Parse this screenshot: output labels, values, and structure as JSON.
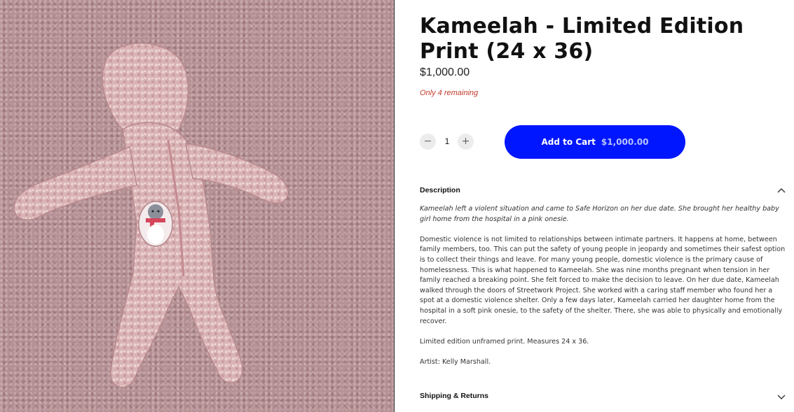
{
  "product": {
    "title": "Kameelah - Limited Edition Print (24 x 36)",
    "price": "$1,000.00",
    "stock_note": "Only 4 remaining",
    "image_subject": "pink fleece baby onesie with penguin patch on textured pink rug"
  },
  "quantity": {
    "minus_icon": "minus-icon",
    "value": "1",
    "plus_icon": "plus-icon"
  },
  "cart": {
    "label": "Add to Cart",
    "price": "$1,000.00",
    "color": "#0016ff"
  },
  "description": {
    "title": "Description",
    "state": "expanded",
    "intro": "Kameelah left a violent situation and came to Safe Horizon on her due date. She brought her healthy baby girl home from the hospital in a pink onesie.",
    "body": "Domestic violence is not limited to relationships between intimate partners. It happens at home, between family members, too. This can put the safety of young people in jeopardy and sometimes their safest option is to collect their things and leave. For many young people, domestic violence is the primary cause of homelessness. This is what happened to Kameelah. She was nine months pregnant when tension in her family reached a breaking point. She felt forced to make the decision to leave. On her due date, Kameelah walked through the doors of Streetwork Project. She worked with a caring staff member who found her a spot at a domestic violence shelter. Only a few days later, Kameelah carried her daughter home from the hospital in a soft pink onesie, to the safety of the shelter. There, she was able to physically and emotionally recover.",
    "edition": "Limited edition unframed print. Measures 24 x 36.",
    "artist": "Artist: Kelly Marshall."
  },
  "shipping": {
    "title": "Shipping & Returns",
    "state": "collapsed"
  },
  "colors": {
    "accent": "#0016ff",
    "stock_warning": "#c0392b"
  }
}
